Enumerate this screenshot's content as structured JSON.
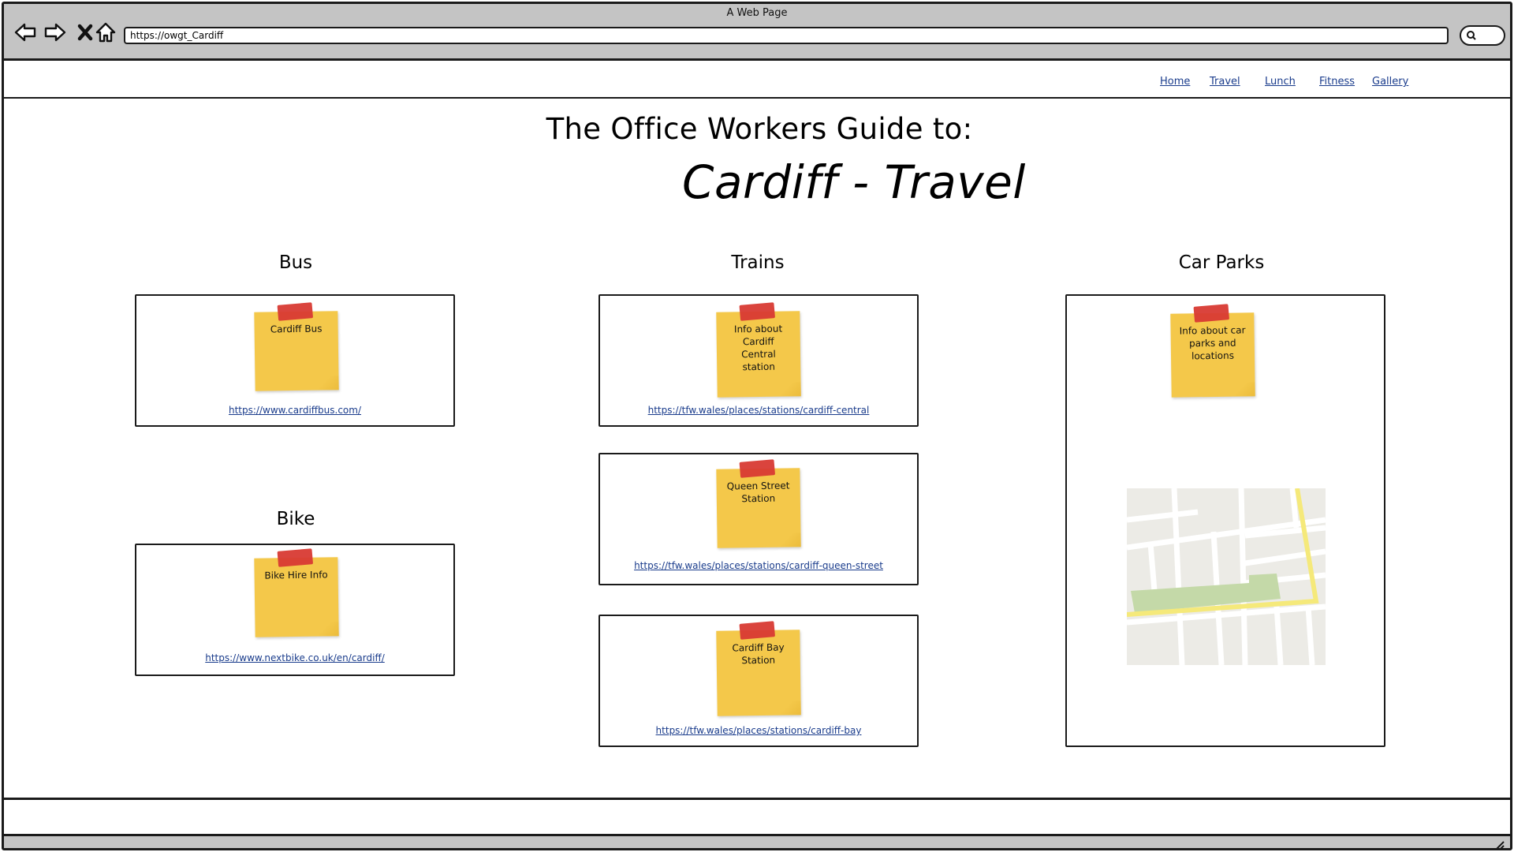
{
  "window": {
    "title": "A Web Page"
  },
  "browser": {
    "url": "https://owgt_Cardiff"
  },
  "nav": {
    "items": [
      {
        "label": "Home"
      },
      {
        "label": "Travel"
      },
      {
        "label": "Lunch"
      },
      {
        "label": "Fitness"
      },
      {
        "label": "Gallery"
      }
    ]
  },
  "page": {
    "heading": "The Office Workers Guide to:",
    "subheading": "Cardiff - Travel"
  },
  "sections": {
    "bus": {
      "title": "Bus",
      "note": "Cardiff Bus",
      "link": "https://www.cardiffbus.com/"
    },
    "bike": {
      "title": "Bike",
      "note": "Bike Hire Info",
      "link": "https://www.nextbike.co.uk/en/cardiff/"
    },
    "trains": {
      "title": "Trains",
      "cards": [
        {
          "note": "Info about Cardiff Central station",
          "link": "https://tfw.wales/places/stations/cardiff-central"
        },
        {
          "note": "Queen Street Station",
          "link": "https://tfw.wales/places/stations/cardiff-queen-street"
        },
        {
          "note": "Cardiff Bay Station",
          "link": "https://tfw.wales/places/stations/cardiff-bay"
        }
      ]
    },
    "carparks": {
      "title": "Car Parks",
      "note": "Info about car parks and locations"
    }
  },
  "colors": {
    "sticky": "#f4c84a",
    "tape": "#d83a33",
    "link": "#1a3c8c",
    "chrome": "#c4c4c4",
    "map_bg": "#ecebe6",
    "map_park": "#c4d9a8",
    "map_road_major": "#f5e97a"
  }
}
